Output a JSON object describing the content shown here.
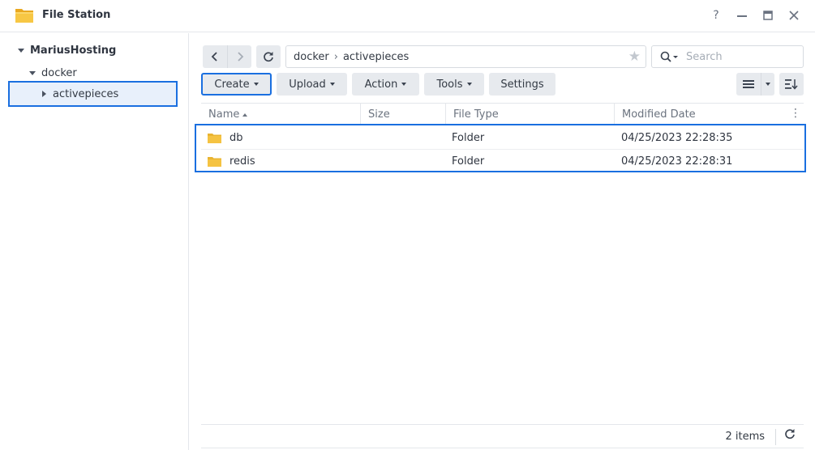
{
  "window": {
    "title": "File Station",
    "help": "?",
    "minimize": "—",
    "maximize": "☐",
    "close": "✕"
  },
  "sidebar": {
    "root": "MariusHosting",
    "folder": "docker",
    "subfolder": "activepieces"
  },
  "toolbar": {
    "path": [
      "docker",
      "activepieces"
    ],
    "path_separator": "›",
    "search_placeholder": "Search",
    "buttons": {
      "create": "Create",
      "upload": "Upload",
      "action": "Action",
      "tools": "Tools",
      "settings": "Settings"
    }
  },
  "table": {
    "columns": [
      "Name",
      "Size",
      "File Type",
      "Modified Date"
    ],
    "rows": [
      {
        "name": "db",
        "size": "",
        "type": "Folder",
        "modified": "04/25/2023 22:28:35"
      },
      {
        "name": "redis",
        "size": "",
        "type": "Folder",
        "modified": "04/25/2023 22:28:31"
      }
    ]
  },
  "footer": {
    "count": "2 items"
  },
  "colors": {
    "accent": "#1a6fe0",
    "folder": "#f5c342",
    "button_bg": "#e7eaee"
  }
}
